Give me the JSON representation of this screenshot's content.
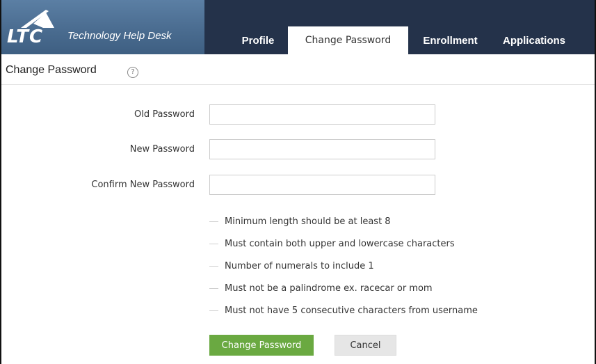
{
  "brand": {
    "logo_text": "LTC",
    "subtitle": "Technology Help Desk"
  },
  "tabs": [
    {
      "label": "Profile",
      "active": false
    },
    {
      "label": "Change Password",
      "active": true
    },
    {
      "label": "Enrollment",
      "active": false
    },
    {
      "label": "Applications",
      "active": false
    }
  ],
  "page": {
    "title": "Change Password",
    "help_icon_glyph": "?"
  },
  "form": {
    "fields": [
      {
        "label": "Old Password",
        "value": ""
      },
      {
        "label": "New Password",
        "value": ""
      },
      {
        "label": "Confirm New Password",
        "value": ""
      }
    ],
    "rules": [
      "Minimum length should be at least 8",
      "Must contain both upper and lowercase characters",
      "Number of numerals to include 1",
      "Must not be a palindrome ex. racecar or mom",
      "Must not have 5 consecutive characters from username"
    ],
    "submit_label": "Change Password",
    "cancel_label": "Cancel"
  },
  "colors": {
    "header_bg": "#24324a",
    "brand_bg": "#4a6c90",
    "primary_button": "#6aa941",
    "cancel_button": "#e6e6e6"
  }
}
